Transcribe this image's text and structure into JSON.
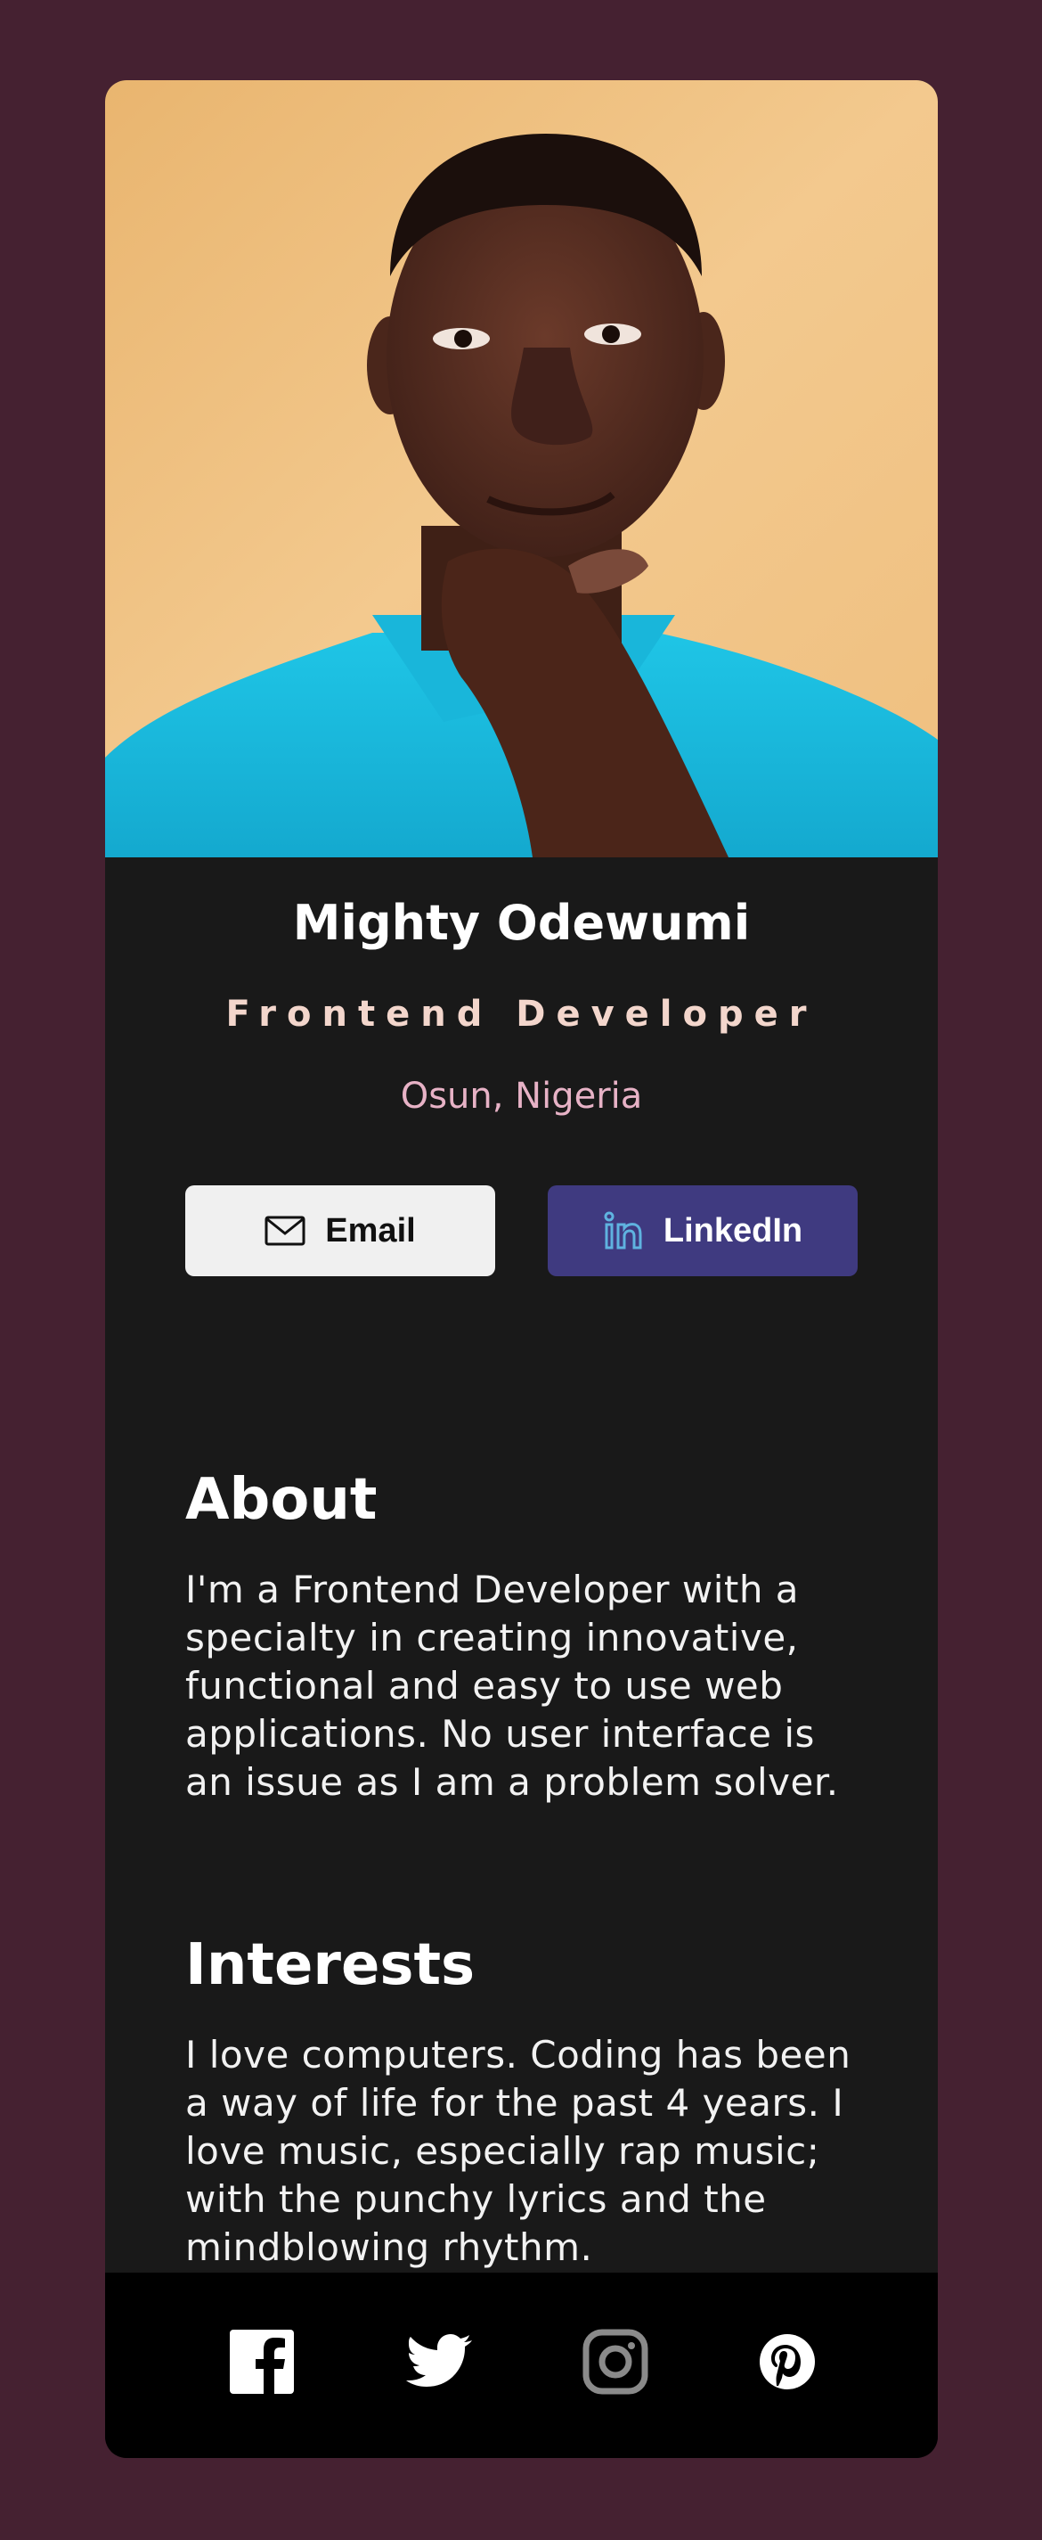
{
  "profile": {
    "name": "Mighty Odewumi",
    "title": "Frontend Developer",
    "location": "Osun, Nigeria",
    "photo_icon": "profile-photo"
  },
  "buttons": {
    "email_label": "Email",
    "email_icon": "mail-icon",
    "linkedin_label": "LinkedIn",
    "linkedin_icon": "linkedin-icon"
  },
  "about": {
    "heading": "About",
    "text": "I'm a Frontend Developer with a specialty in creating innovative, functional and easy to use web applications. No user interface is an issue as I am a problem solver."
  },
  "interests": {
    "heading": "Interests",
    "text": "I love computers. Coding has been a way of life for the past 4 years. I love music, especially rap music; with the punchy lyrics and the mindblowing rhythm."
  },
  "footer": {
    "icons": [
      "facebook-icon",
      "twitter-icon",
      "instagram-icon",
      "pinterest-icon"
    ]
  },
  "colors": {
    "page_background": "#452131",
    "card_background": "#191919",
    "footer_background": "#000000",
    "linkedin_button": "#3f3a80",
    "email_button": "#f0f0f0",
    "title_color": "#f3d6cc",
    "location_color": "#e7b2c6"
  }
}
